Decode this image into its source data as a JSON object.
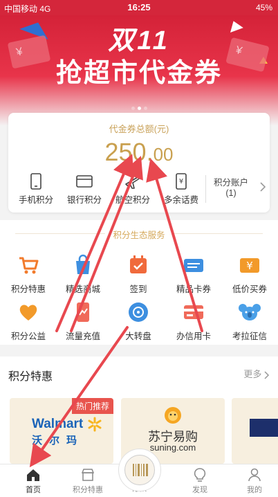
{
  "status_bar": {
    "carrier": "中国移动",
    "network": "4G",
    "time": "16:25",
    "battery": "45%"
  },
  "banner": {
    "title_line1": "双11",
    "title_line2": "抢超市代金券"
  },
  "voucher": {
    "label": "代金券总额(元)",
    "amount_int": "250.",
    "amount_dec": "00",
    "items": [
      {
        "label": "手机积分",
        "icon": "phone-icon"
      },
      {
        "label": "银行积分",
        "icon": "bank-card-icon"
      },
      {
        "label": "航空积分",
        "icon": "airplane-icon"
      },
      {
        "label": "多余话费",
        "icon": "yen-phone-icon"
      }
    ],
    "account": {
      "label": "积分账户",
      "count": "(1)"
    }
  },
  "services": {
    "title": "积分生态服务",
    "items": [
      {
        "label": "积分特惠",
        "icon": "cart-icon",
        "color": "#f27b2c"
      },
      {
        "label": "精选商城",
        "icon": "shopping-bag-icon",
        "color": "#3d8fe0"
      },
      {
        "label": "签到",
        "icon": "calendar-check-icon",
        "color": "#f06a3c"
      },
      {
        "label": "精品卡券",
        "icon": "ticket-icon",
        "color": "#3d8fe0"
      },
      {
        "label": "低价买券",
        "icon": "yen-coupon-icon",
        "color": "#f29a2a"
      },
      {
        "label": "积分公益",
        "icon": "heart-icon",
        "color": "#f29a2a"
      },
      {
        "label": "流量充值",
        "icon": "data-phone-icon",
        "color": "#f06a5a"
      },
      {
        "label": "大转盘",
        "icon": "wheel-icon",
        "color": "#3d8fe0"
      },
      {
        "label": "办信用卡",
        "icon": "credit-card-icon",
        "color": "#f06a5a"
      },
      {
        "label": "考拉征信",
        "icon": "koala-icon",
        "color": "#4aa0e8"
      }
    ]
  },
  "points": {
    "title": "积分特惠",
    "more": "更多",
    "promos": [
      {
        "tag": "热门推荐",
        "brand_en": "Walmart",
        "brand_cn": "沃尔玛"
      },
      {
        "brand_cn": "苏宁易购",
        "brand_en": "suning.com"
      }
    ]
  },
  "tabs": [
    {
      "label": "首页",
      "icon": "home-icon",
      "active": true
    },
    {
      "label": "积分特惠",
      "icon": "shop-icon",
      "active": false
    },
    {
      "label": "付款",
      "icon": "barcode-icon",
      "active": false
    },
    {
      "label": "发现",
      "icon": "bulb-icon",
      "active": false
    },
    {
      "label": "我的",
      "icon": "user-icon",
      "active": false
    }
  ],
  "colors": {
    "brand_red": "#d4263b",
    "gold": "#c9a04f",
    "annotation_arrow": "#e8484f"
  }
}
